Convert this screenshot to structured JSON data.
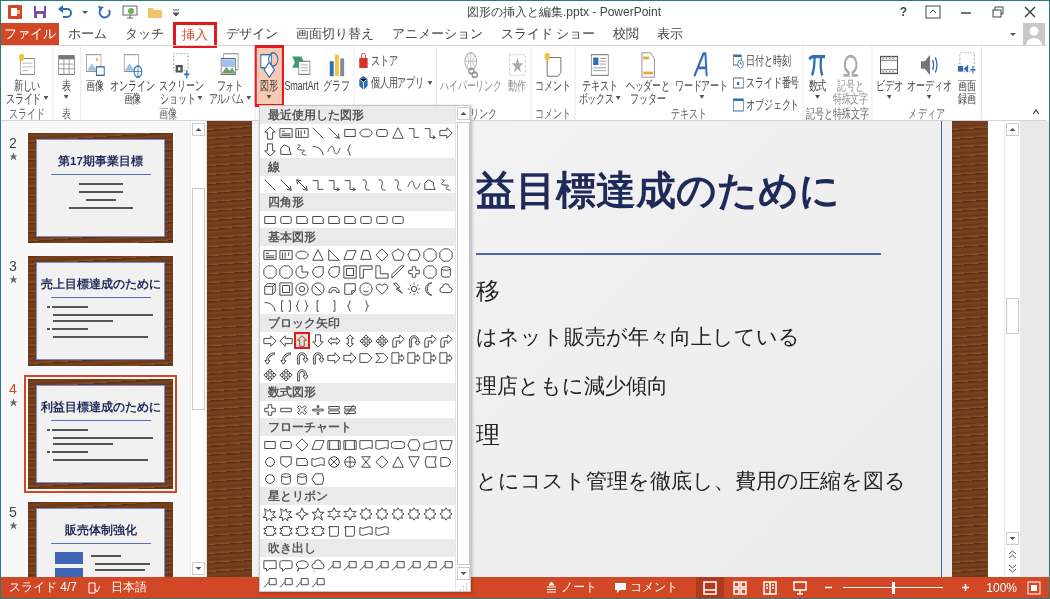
{
  "window": {
    "title": "図形の挿入と編集.pptx - PowerPoint",
    "help": "?"
  },
  "tabs": {
    "file": "ファイル",
    "items": [
      {
        "label": "ホーム",
        "selected": false,
        "highlighted": false
      },
      {
        "label": "タッチ",
        "selected": false,
        "highlighted": false
      },
      {
        "label": "挿入",
        "selected": true,
        "highlighted": true
      },
      {
        "label": "デザイン",
        "selected": false,
        "highlighted": false
      },
      {
        "label": "画面切り替え",
        "selected": false,
        "highlighted": false
      },
      {
        "label": "アニメーション",
        "selected": false,
        "highlighted": false
      },
      {
        "label": "スライド ショー",
        "selected": false,
        "highlighted": false
      },
      {
        "label": "校閲",
        "selected": false,
        "highlighted": false
      },
      {
        "label": "表示",
        "selected": false,
        "highlighted": false
      }
    ]
  },
  "ribbon": {
    "groups": [
      {
        "label": "スライド",
        "buttons": [
          {
            "kind": "large",
            "lines": [
              "新しい",
              "スライド"
            ],
            "dropdown": true,
            "disabled": false,
            "pressed": false,
            "highlighted": false
          }
        ]
      },
      {
        "label": "表",
        "buttons": [
          {
            "kind": "large",
            "lines": [
              "表"
            ],
            "dropdown": true,
            "disabled": false,
            "pressed": false,
            "highlighted": false
          }
        ]
      },
      {
        "label": "画像",
        "buttons": [
          {
            "kind": "large",
            "lines": [
              "画像"
            ],
            "dropdown": false,
            "disabled": false,
            "pressed": false,
            "highlighted": false
          },
          {
            "kind": "large",
            "lines": [
              "オンライン",
              "画像"
            ],
            "dropdown": false,
            "disabled": false,
            "pressed": false,
            "highlighted": false
          },
          {
            "kind": "large",
            "lines": [
              "スクリーン",
              "ショット"
            ],
            "dropdown": true,
            "disabled": false,
            "pressed": false,
            "highlighted": false
          },
          {
            "kind": "large",
            "lines": [
              "フォト",
              "アルバム"
            ],
            "dropdown": true,
            "disabled": false,
            "pressed": false,
            "highlighted": false
          }
        ]
      },
      {
        "buttons": [
          {
            "kind": "large",
            "lines": [
              "図形"
            ],
            "dropdown": true,
            "disabled": false,
            "pressed": true,
            "highlighted": true
          },
          {
            "kind": "large",
            "lines": [
              "SmartArt"
            ],
            "dropdown": false,
            "disabled": false,
            "pressed": false,
            "highlighted": false
          },
          {
            "kind": "large",
            "lines": [
              "グラフ"
            ],
            "dropdown": false,
            "disabled": false,
            "pressed": false,
            "highlighted": false
          }
        ]
      },
      {
        "buttons": [
          {
            "kind": "small",
            "lines": [
              "ストア"
            ],
            "dropdown": false,
            "disabled": false,
            "pressed": false,
            "highlighted": false
          },
          {
            "kind": "small",
            "lines": [
              "個人用アプリ"
            ],
            "dropdown": true,
            "disabled": false,
            "pressed": false,
            "highlighted": false
          }
        ]
      },
      {
        "label": "リンク",
        "buttons": [
          {
            "kind": "large",
            "lines": [
              "ハイパーリンク"
            ],
            "dropdown": false,
            "disabled": true,
            "pressed": false,
            "highlighted": false
          },
          {
            "kind": "large",
            "lines": [
              "動作"
            ],
            "dropdown": false,
            "disabled": true,
            "pressed": false,
            "highlighted": false
          }
        ]
      },
      {
        "label": "コメント",
        "buttons": [
          {
            "kind": "large",
            "lines": [
              "コメント"
            ],
            "dropdown": false,
            "disabled": false,
            "pressed": false,
            "highlighted": false
          }
        ]
      },
      {
        "label": "テキスト",
        "buttons": [
          {
            "kind": "large",
            "lines": [
              "テキスト",
              "ボックス"
            ],
            "dropdown": true,
            "disabled": false,
            "pressed": false,
            "highlighted": false
          },
          {
            "kind": "large",
            "lines": [
              "ヘッダーと",
              "フッター"
            ],
            "dropdown": false,
            "disabled": false,
            "pressed": false,
            "highlighted": false
          },
          {
            "kind": "large",
            "lines": [
              "ワードアート"
            ],
            "dropdown": true,
            "disabled": false,
            "pressed": false,
            "highlighted": false
          },
          {
            "kind": "small",
            "lines": [
              "日付と時刻"
            ],
            "dropdown": false,
            "disabled": false,
            "pressed": false,
            "highlighted": false
          },
          {
            "kind": "small",
            "lines": [
              "スライド番号"
            ],
            "dropdown": false,
            "disabled": false,
            "pressed": false,
            "highlighted": false
          },
          {
            "kind": "small",
            "lines": [
              "オブジェクト"
            ],
            "dropdown": false,
            "disabled": false,
            "pressed": false,
            "highlighted": false
          }
        ]
      },
      {
        "label": "記号と特殊文字",
        "buttons": [
          {
            "kind": "large",
            "lines": [
              "数式"
            ],
            "dropdown": true,
            "disabled": false,
            "pressed": false,
            "highlighted": false
          },
          {
            "kind": "large",
            "lines": [
              "記号と",
              "特殊文字"
            ],
            "dropdown": false,
            "disabled": true,
            "pressed": false,
            "highlighted": false
          }
        ]
      },
      {
        "label": "メディア",
        "buttons": [
          {
            "kind": "large",
            "lines": [
              "ビデオ"
            ],
            "dropdown": true,
            "disabled": false,
            "pressed": false,
            "highlighted": false
          },
          {
            "kind": "large",
            "lines": [
              "オーディオ"
            ],
            "dropdown": true,
            "disabled": false,
            "pressed": false,
            "highlighted": false
          },
          {
            "kind": "large",
            "lines": [
              "画面",
              "録画"
            ],
            "dropdown": false,
            "disabled": false,
            "pressed": false,
            "highlighted": false
          }
        ]
      }
    ]
  },
  "thumbnails": [
    {
      "number": "2",
      "title": "第17期事業目標",
      "kind": "centered",
      "animated": true,
      "selected": false
    },
    {
      "number": "3",
      "title": "売上目標達成のために",
      "kind": "bullets",
      "animated": true,
      "selected": false
    },
    {
      "number": "4",
      "title": "利益目標達成のために",
      "kind": "bullets",
      "animated": true,
      "selected": true
    },
    {
      "number": "5",
      "title": "販売体制強化",
      "kind": "diagram",
      "animated": true,
      "selected": false
    }
  ],
  "slide": {
    "title": "益目標達成のために",
    "lines": [
      {
        "kind": "heading",
        "text": "移"
      },
      {
        "kind": "bullet",
        "text": "はネット販売が年々向上している"
      },
      {
        "kind": "bullet",
        "text": "理店ともに減少傾向"
      },
      {
        "kind": "heading",
        "text": "理"
      },
      {
        "kind": "bullet",
        "text": "とにコスト管理を徹底し、費用の圧縮を図る"
      }
    ]
  },
  "shapes_gallery": {
    "categories": [
      {
        "label": "最近使用した図形",
        "shapes": [
          {
            "kind": "up-arrow",
            "selected": false
          },
          {
            "kind": "text-box",
            "selected": false
          },
          {
            "kind": "vertical-text-box",
            "selected": false
          },
          {
            "kind": "line",
            "selected": false
          },
          {
            "kind": "arrow-line",
            "selected": false
          },
          {
            "kind": "rect",
            "selected": false
          },
          {
            "kind": "ellipse",
            "selected": false
          },
          {
            "kind": "rounded",
            "selected": false
          },
          {
            "kind": "triangle",
            "selected": false
          },
          {
            "kind": "elbow",
            "selected": false
          },
          {
            "kind": "elbow-arrow",
            "selected": false
          },
          {
            "kind": "right-arrow",
            "selected": false
          },
          {
            "kind": "down-arrow",
            "selected": false
          },
          {
            "kind": "freeform",
            "selected": false
          },
          {
            "kind": "scribble",
            "selected": false
          },
          {
            "kind": "arc",
            "selected": false
          },
          {
            "kind": "curve",
            "selected": false
          },
          {
            "kind": "left-brace",
            "selected": false
          }
        ]
      },
      {
        "label": "線",
        "shapes": [
          {
            "kind": "line",
            "selected": false
          },
          {
            "kind": "arrow-line",
            "selected": false
          },
          {
            "kind": "double-arrow-line",
            "selected": false
          },
          {
            "kind": "elbow",
            "selected": false
          },
          {
            "kind": "elbow-arrow",
            "selected": false
          },
          {
            "kind": "elbow-arrow",
            "selected": false
          },
          {
            "kind": "s-curve",
            "selected": false
          },
          {
            "kind": "s-curve",
            "selected": false
          },
          {
            "kind": "s-curve",
            "selected": false
          },
          {
            "kind": "curve",
            "selected": false
          },
          {
            "kind": "freeform",
            "selected": false
          },
          {
            "kind": "scribble",
            "selected": false
          }
        ]
      },
      {
        "label": "四角形",
        "shapes": [
          {
            "kind": "rect",
            "selected": false
          },
          {
            "kind": "rounded",
            "selected": false
          },
          {
            "kind": "snip",
            "selected": false
          },
          {
            "kind": "snip",
            "selected": false
          },
          {
            "kind": "snip",
            "selected": false
          },
          {
            "kind": "snip",
            "selected": false
          },
          {
            "kind": "rounded",
            "selected": false
          },
          {
            "kind": "rounded",
            "selected": false
          },
          {
            "kind": "rounded",
            "selected": false
          }
        ]
      },
      {
        "label": "基本図形",
        "shapes": [
          {
            "kind": "text-box",
            "selected": false
          },
          {
            "kind": "vertical-text-box",
            "selected": false
          },
          {
            "kind": "ellipse",
            "selected": false
          },
          {
            "kind": "triangle",
            "selected": false
          },
          {
            "kind": "right-triangle",
            "selected": false
          },
          {
            "kind": "parallelogram",
            "selected": false
          },
          {
            "kind": "trapezoid",
            "selected": false
          },
          {
            "kind": "diamond",
            "selected": false
          },
          {
            "kind": "pentagon",
            "selected": false
          },
          {
            "kind": "hexagon",
            "selected": false
          },
          {
            "kind": "octagon",
            "selected": false
          },
          {
            "kind": "octagon",
            "selected": false
          },
          {
            "kind": "octagon",
            "selected": false
          },
          {
            "kind": "octagon",
            "selected": false
          },
          {
            "kind": "pie",
            "selected": false
          },
          {
            "kind": "teardrop",
            "selected": false
          },
          {
            "kind": "teardrop",
            "selected": false
          },
          {
            "kind": "frame",
            "selected": false
          },
          {
            "kind": "corner",
            "selected": false
          },
          {
            "kind": "l-shape",
            "selected": false
          },
          {
            "kind": "diagonal",
            "selected": false
          },
          {
            "kind": "cross",
            "selected": false
          },
          {
            "kind": "octagon",
            "selected": false
          },
          {
            "kind": "can",
            "selected": false
          },
          {
            "kind": "cube",
            "selected": false
          },
          {
            "kind": "frame",
            "selected": false
          },
          {
            "kind": "donut",
            "selected": false
          },
          {
            "kind": "no-symbol",
            "selected": false
          },
          {
            "kind": "block-arc",
            "selected": false
          },
          {
            "kind": "folded-corner",
            "selected": false
          },
          {
            "kind": "smiley",
            "selected": false
          },
          {
            "kind": "heart",
            "selected": false
          },
          {
            "kind": "lightning",
            "selected": false
          },
          {
            "kind": "sun",
            "selected": false
          },
          {
            "kind": "moon",
            "selected": false
          },
          {
            "kind": "cloud",
            "selected": false
          },
          {
            "kind": "arc",
            "selected": false
          },
          {
            "kind": "bracket-pair",
            "selected": false
          },
          {
            "kind": "brace-pair",
            "selected": false
          },
          {
            "kind": "left-bracket",
            "selected": false
          },
          {
            "kind": "right-bracket",
            "selected": false
          },
          {
            "kind": "left-brace",
            "selected": false
          },
          {
            "kind": "right-brace",
            "selected": false
          }
        ]
      },
      {
        "label": "ブロック矢印",
        "shapes": [
          {
            "kind": "right-arrow",
            "selected": false
          },
          {
            "kind": "left-arrow",
            "selected": false
          },
          {
            "kind": "up-arrow",
            "selected": true
          },
          {
            "kind": "down-arrow",
            "selected": false
          },
          {
            "kind": "lr-arrow",
            "selected": false
          },
          {
            "kind": "ud-arrow",
            "selected": false
          },
          {
            "kind": "quad-arrow",
            "selected": false
          },
          {
            "kind": "quad-arrow",
            "selected": false
          },
          {
            "kind": "bent-arrow",
            "selected": false
          },
          {
            "kind": "uturn",
            "selected": false
          },
          {
            "kind": "bent-arrow",
            "selected": false
          },
          {
            "kind": "bent-arrow",
            "selected": false
          },
          {
            "kind": "curved-arrow",
            "selected": false
          },
          {
            "kind": "curved-arrow",
            "selected": false
          },
          {
            "kind": "uturn",
            "selected": false
          },
          {
            "kind": "uturn",
            "selected": false
          },
          {
            "kind": "right-arrow",
            "selected": false
          },
          {
            "kind": "right-arrow",
            "selected": false
          },
          {
            "kind": "pointed-rect",
            "selected": false
          },
          {
            "kind": "chevron",
            "selected": false
          },
          {
            "kind": "arrow-callout",
            "selected": false
          },
          {
            "kind": "arrow-callout",
            "selected": false
          },
          {
            "kind": "arrow-callout",
            "selected": false
          },
          {
            "kind": "arrow-callout",
            "selected": false
          },
          {
            "kind": "quad-arrow",
            "selected": false
          },
          {
            "kind": "quad-arrow",
            "selected": false
          },
          {
            "kind": "uturn",
            "selected": false
          }
        ]
      },
      {
        "label": "数式図形",
        "shapes": [
          {
            "kind": "plus-sign",
            "selected": false
          },
          {
            "kind": "minus-sign",
            "selected": false
          },
          {
            "kind": "multiply-sign",
            "selected": false
          },
          {
            "kind": "divide-sign",
            "selected": false
          },
          {
            "kind": "equal-sign",
            "selected": false
          },
          {
            "kind": "not-equal-sign",
            "selected": false
          }
        ]
      },
      {
        "label": "フローチャート",
        "shapes": [
          {
            "kind": "rect",
            "selected": false
          },
          {
            "kind": "rounded",
            "selected": false
          },
          {
            "kind": "diamond",
            "selected": false
          },
          {
            "kind": "parallelogram",
            "selected": false
          },
          {
            "kind": "striped-rect",
            "selected": false
          },
          {
            "kind": "striped-rect",
            "selected": false
          },
          {
            "kind": "wavy-rect",
            "selected": false
          },
          {
            "kind": "wavy-rect",
            "selected": false
          },
          {
            "kind": "stadium",
            "selected": false
          },
          {
            "kind": "hexagon",
            "selected": false
          },
          {
            "kind": "slanted-rect",
            "selected": false
          },
          {
            "kind": "inverted-trapezoid",
            "selected": false
          },
          {
            "kind": "circle",
            "selected": false
          },
          {
            "kind": "pentagon-down",
            "selected": false
          },
          {
            "kind": "snip",
            "selected": false
          },
          {
            "kind": "wave",
            "selected": false
          },
          {
            "kind": "x-circle",
            "selected": false
          },
          {
            "kind": "plus-circle",
            "selected": false
          },
          {
            "kind": "hourglass",
            "selected": false
          },
          {
            "kind": "diamond",
            "selected": false
          },
          {
            "kind": "triangle",
            "selected": false
          },
          {
            "kind": "merge",
            "selected": false
          },
          {
            "kind": "curved-rect",
            "selected": false
          },
          {
            "kind": "d-shape",
            "selected": false
          },
          {
            "kind": "circle",
            "selected": false
          },
          {
            "kind": "can",
            "selected": false
          },
          {
            "kind": "can",
            "selected": false
          },
          {
            "kind": "bullet-shape",
            "selected": false
          }
        ]
      },
      {
        "label": "星とリボン",
        "shapes": [
          {
            "kind": "burst",
            "selected": false
          },
          {
            "kind": "burst",
            "selected": false
          },
          {
            "kind": "star4",
            "selected": false
          },
          {
            "kind": "star5",
            "selected": false
          },
          {
            "kind": "star6",
            "selected": false
          },
          {
            "kind": "star6",
            "selected": false
          },
          {
            "kind": "star8",
            "selected": false
          },
          {
            "kind": "star8",
            "selected": false
          },
          {
            "kind": "star8",
            "selected": false
          },
          {
            "kind": "star8",
            "selected": false
          },
          {
            "kind": "star8",
            "selected": false
          },
          {
            "kind": "star8",
            "selected": false
          },
          {
            "kind": "ribbon",
            "selected": false
          },
          {
            "kind": "ribbon",
            "selected": false
          },
          {
            "kind": "ribbon",
            "selected": false
          },
          {
            "kind": "ribbon",
            "selected": false
          },
          {
            "kind": "scroll",
            "selected": false
          },
          {
            "kind": "scroll",
            "selected": false
          },
          {
            "kind": "wave",
            "selected": false
          },
          {
            "kind": "wave",
            "selected": false
          }
        ]
      },
      {
        "label": "吹き出し",
        "shapes": [
          {
            "kind": "callout-rect",
            "selected": false
          },
          {
            "kind": "callout-rounded",
            "selected": false
          },
          {
            "kind": "callout-oval",
            "selected": false
          },
          {
            "kind": "callout-cloud",
            "selected": false
          },
          {
            "kind": "line-callout",
            "selected": false
          },
          {
            "kind": "line-callout",
            "selected": false
          },
          {
            "kind": "line-callout",
            "selected": false
          },
          {
            "kind": "line-callout",
            "selected": false
          },
          {
            "kind": "line-callout",
            "selected": false
          },
          {
            "kind": "line-callout",
            "selected": false
          },
          {
            "kind": "line-callout",
            "selected": false
          },
          {
            "kind": "line-callout",
            "selected": false
          },
          {
            "kind": "line-callout",
            "selected": false
          },
          {
            "kind": "line-callout",
            "selected": false
          },
          {
            "kind": "line-callout",
            "selected": false
          },
          {
            "kind": "line-callout",
            "selected": false
          }
        ]
      }
    ]
  },
  "status_bar": {
    "slide": "スライド 4/7",
    "language": "日本語",
    "notes": "ノート",
    "comments": "コメント",
    "views": [
      {
        "selected": true
      },
      {
        "selected": false
      },
      {
        "selected": false
      },
      {
        "selected": false
      }
    ],
    "zoom": {
      "level": 0.5,
      "reading": "100%"
    }
  }
}
